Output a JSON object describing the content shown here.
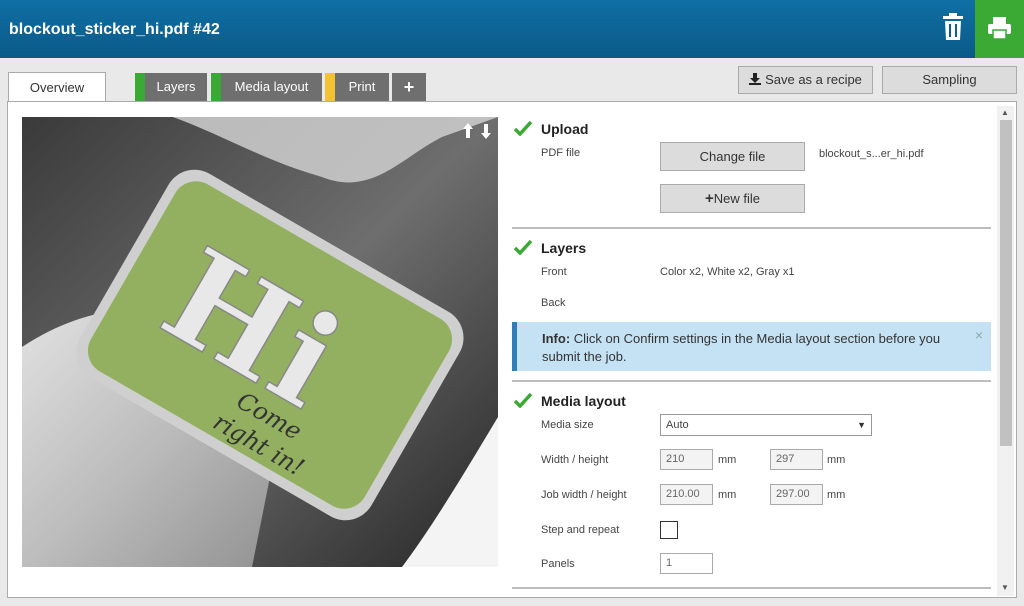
{
  "header": {
    "title": "blockout_sticker_hi.pdf #42",
    "trash_icon": "trash-icon",
    "print_icon": "printer-icon",
    "print_color": "#3aaa35"
  },
  "tabs": [
    {
      "label": "Overview"
    },
    {
      "label": "Layers",
      "color": "#3aaa35"
    },
    {
      "label": "Media layout",
      "color": "#3aaa35"
    },
    {
      "label": "Print",
      "color": "#f2c232"
    },
    {
      "label": "+"
    }
  ],
  "toolbar": {
    "save_recipe_label": "Save as a recipe",
    "sampling_label": "Sampling"
  },
  "preview": {
    "sticker_big": "Hi",
    "sticker_small_1": "Come",
    "sticker_small_2": "right in!"
  },
  "upload": {
    "title": "Upload",
    "pdf_label": "PDF file",
    "change_label": "Change file",
    "new_label": "New file",
    "file_name": "blockout_s...er_hi.pdf"
  },
  "layers": {
    "title": "Layers",
    "front_label": "Front",
    "front_value": "Color x2, White x2, Gray x1",
    "back_label": "Back"
  },
  "info": {
    "prefix": "Info:",
    "text": " Click on Confirm settings in the Media layout section before you submit the job.",
    "close": "×"
  },
  "media": {
    "title": "Media layout",
    "size_label": "Media size",
    "size_value": "Auto",
    "wh_label": "Width / height",
    "width": "210",
    "height": "297",
    "unit": "mm",
    "job_label": "Job width / height",
    "job_width": "210.00",
    "job_height": "297.00",
    "step_label": "Step and repeat",
    "panels_label": "Panels",
    "panels_value": "1"
  }
}
